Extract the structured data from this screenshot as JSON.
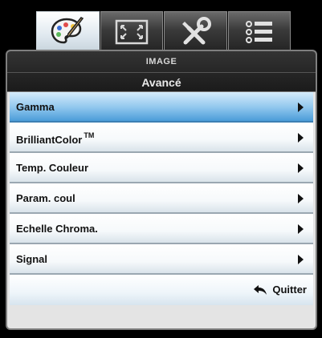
{
  "tabs": [
    {
      "name": "palette-icon",
      "active": true
    },
    {
      "name": "fullscreen-icon",
      "active": false
    },
    {
      "name": "tools-icon",
      "active": false
    },
    {
      "name": "list-icon",
      "active": false
    }
  ],
  "header": {
    "section": "IMAGE",
    "title": "Avancé"
  },
  "menu": {
    "items": [
      {
        "label": "Gamma"
      },
      {
        "label": "BrilliantColor",
        "sup": "TM"
      },
      {
        "label": "Temp. Couleur"
      },
      {
        "label": "Param. coul"
      },
      {
        "label": "Echelle Chroma."
      },
      {
        "label": "Signal"
      }
    ],
    "selected_index": 0
  },
  "footer": {
    "exit_label": "Quitter"
  },
  "colors": {
    "selected_row": "#4b9cd8",
    "panel_border": "#7f7f7f"
  }
}
